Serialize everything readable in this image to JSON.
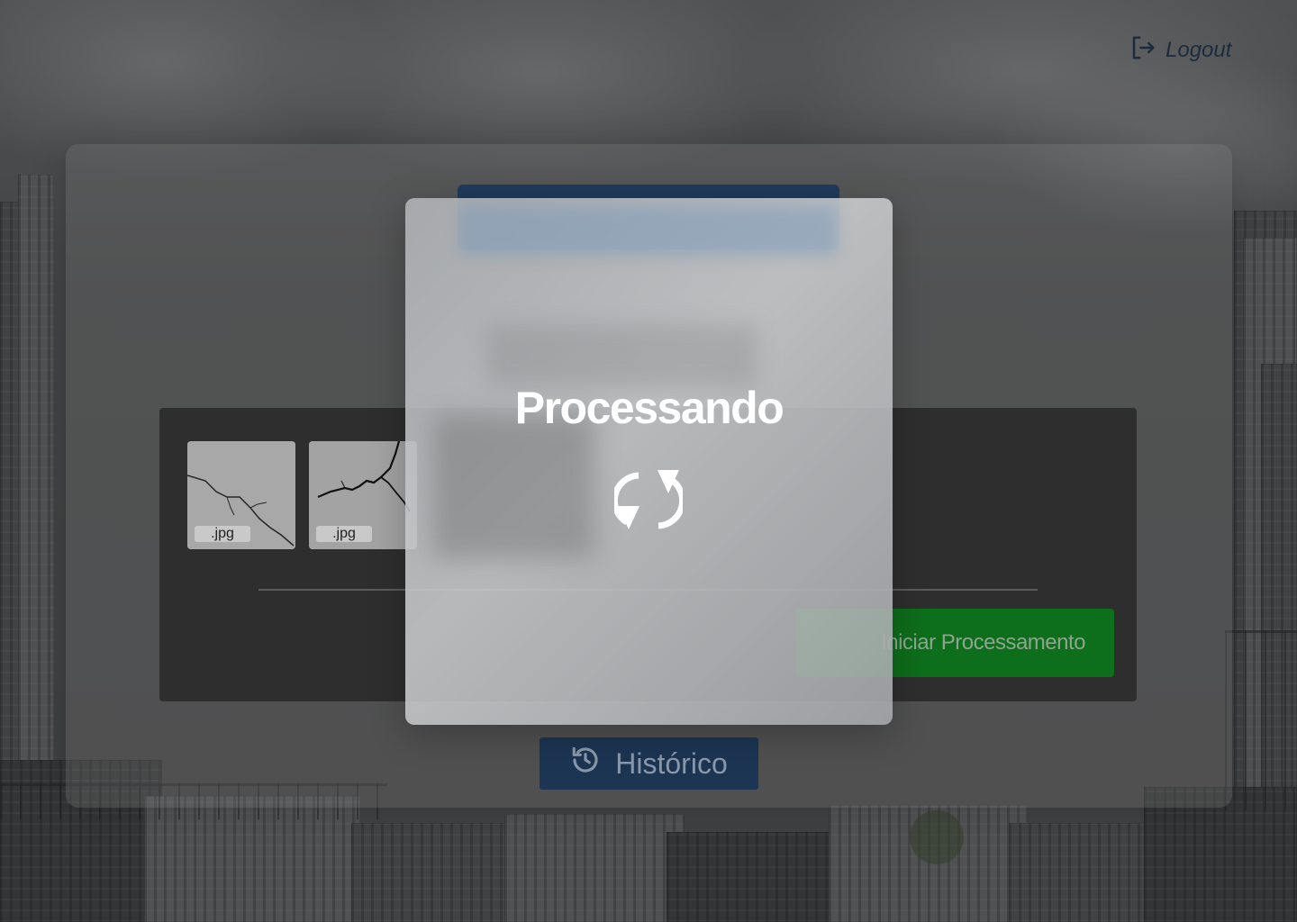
{
  "header": {
    "logout_label": "Logout"
  },
  "upload": {
    "thumbnails": [
      {
        "ext": ".jpg"
      },
      {
        "ext": ".jpg"
      }
    ],
    "start_button_label": "Iniciar Processamento"
  },
  "history_button_label": "Histórico",
  "modal": {
    "title": "Processando"
  },
  "colors": {
    "navy": "#203a5b",
    "green": "#0d6e1b",
    "panel": "#2e2e2e"
  },
  "icons": {
    "logout": "logout-icon",
    "history": "history-icon",
    "sync": "sync-icon"
  }
}
